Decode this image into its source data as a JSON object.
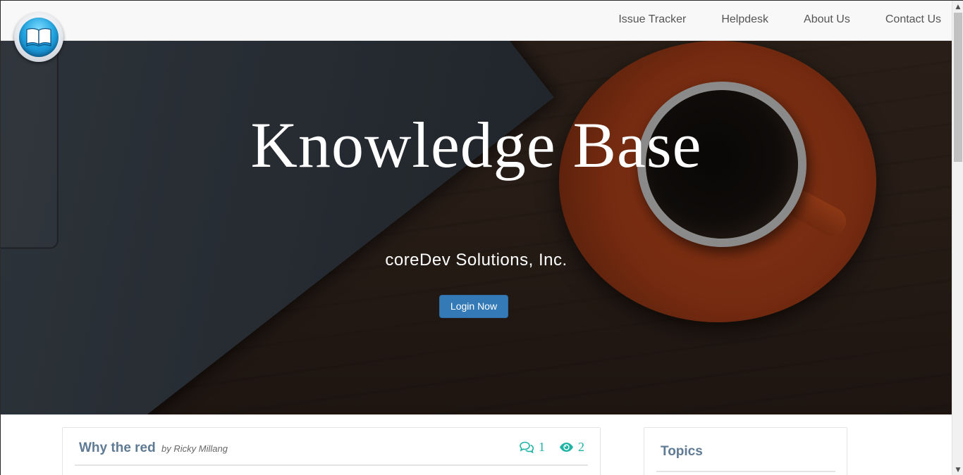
{
  "navbar": {
    "links": [
      {
        "label": "Issue Tracker"
      },
      {
        "label": "Helpdesk"
      },
      {
        "label": "About Us"
      },
      {
        "label": "Contact Us"
      }
    ],
    "logo_icon": "open-book-icon"
  },
  "hero": {
    "title": "Knowledge Base",
    "subtitle": "coreDev Solutions, Inc.",
    "login_button": "Login Now"
  },
  "article": {
    "title": "Why the red",
    "author": "by Ricky Millang",
    "comments_count": "1",
    "views_count": "2",
    "comments_icon": "comments-icon",
    "views_icon": "eye-icon"
  },
  "sidebar": {
    "topics_title": "Topics"
  },
  "colors": {
    "accent": "#337ab7",
    "stat": "#1fb3a4",
    "heading": "#5f7a93"
  }
}
